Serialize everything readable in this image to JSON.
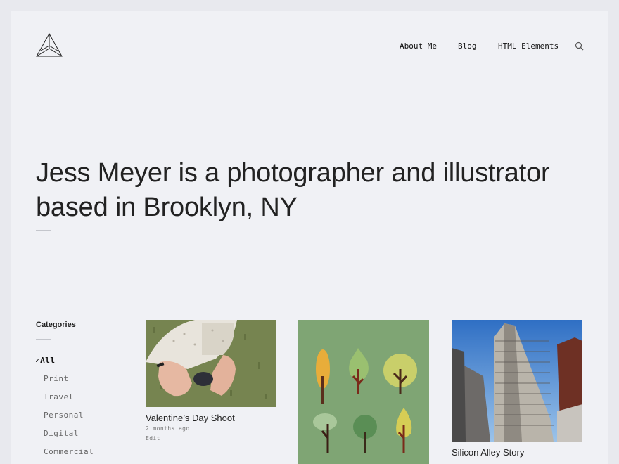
{
  "nav": {
    "items": [
      "About Me",
      "Blog",
      "HTML Elements"
    ],
    "search_icon": "search-icon"
  },
  "hero": {
    "line1": "Jess Meyer is a photographer and illustrator",
    "line2": "based in Brooklyn, NY"
  },
  "categories": {
    "title": "Categories",
    "items": [
      {
        "label": "All",
        "active": true,
        "check": "✓"
      },
      {
        "label": "Print"
      },
      {
        "label": "Travel"
      },
      {
        "label": "Personal"
      },
      {
        "label": "Digital"
      },
      {
        "label": "Commercial"
      }
    ]
  },
  "posts": [
    {
      "title": "Valentine’s Day Shoot",
      "date": "2 months ago",
      "edit": "Edit"
    },
    {
      "title": "",
      "date": "",
      "edit": ""
    },
    {
      "title": "Silicon Alley Story",
      "date": "",
      "edit": ""
    }
  ],
  "colors": {
    "page_bg": "#f0f1f5",
    "outer_bg": "#e8e9ee",
    "text": "#222222",
    "illustration_bg": "#7fa574"
  }
}
